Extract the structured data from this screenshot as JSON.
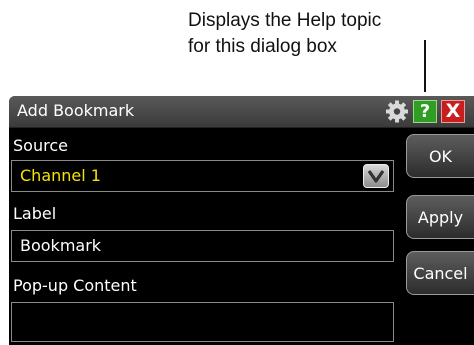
{
  "annotation": {
    "text_line1": "Displays the Help topic",
    "text_line2": "for this dialog box"
  },
  "dialog": {
    "title": "Add Bookmark",
    "title_icons": {
      "settings": "gear-icon",
      "help": "?",
      "close": "X"
    },
    "source": {
      "label": "Source",
      "selected_value": "Channel 1"
    },
    "label_field": {
      "label": "Label",
      "value": "Bookmark"
    },
    "popup_content": {
      "label": "Pop-up Content",
      "value": ""
    },
    "buttons": {
      "ok": "OK",
      "apply": "Apply",
      "cancel": "Cancel"
    },
    "colors": {
      "selected_text": "#f2e600",
      "help_bg": "#2f9e23",
      "close_bg": "#c81e1e"
    }
  }
}
